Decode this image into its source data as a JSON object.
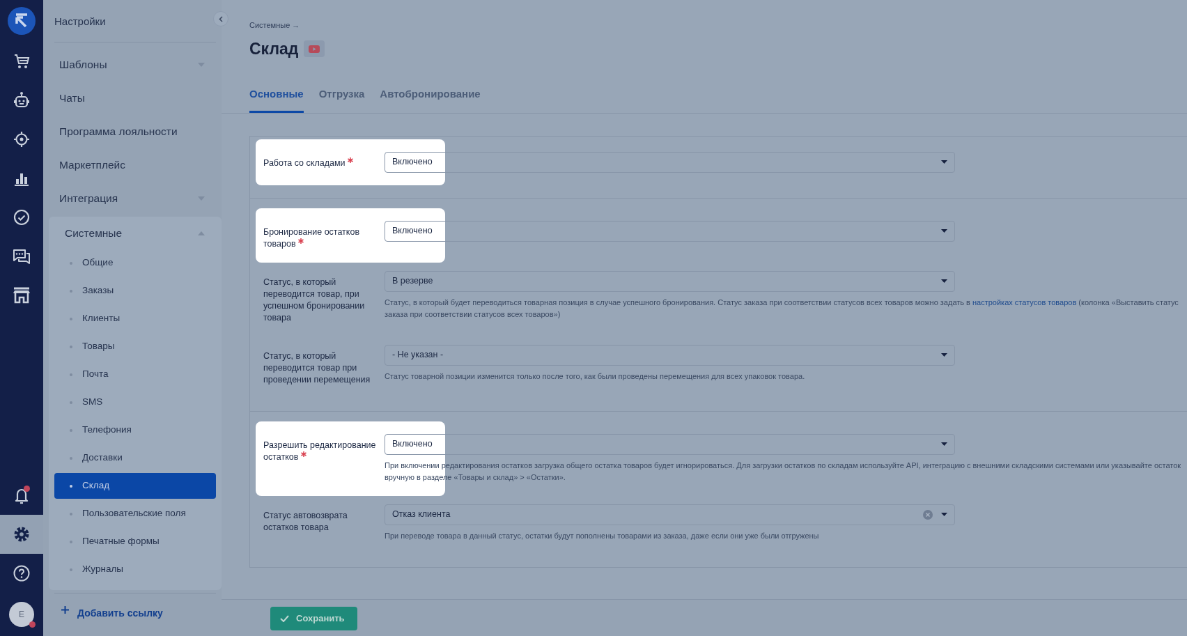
{
  "rail": {
    "top": [
      {
        "kind": "logo",
        "selected": false,
        "notification": false
      },
      {
        "kind": "cart",
        "selected": false,
        "notification": false
      },
      {
        "kind": "robot",
        "selected": false,
        "notification": false
      },
      {
        "kind": "target",
        "selected": false,
        "notification": false
      },
      {
        "kind": "chart",
        "selected": false,
        "notification": false
      },
      {
        "kind": "check",
        "selected": false,
        "notification": false
      },
      {
        "kind": "chat",
        "selected": false,
        "notification": false
      },
      {
        "kind": "store",
        "selected": false,
        "notification": false
      }
    ],
    "bottom": [
      {
        "kind": "bell",
        "selected": false,
        "notification": true
      },
      {
        "kind": "gear",
        "selected": true,
        "notification": false
      },
      {
        "kind": "help",
        "selected": false,
        "notification": false
      }
    ],
    "avatar": {
      "initial": "E",
      "notification": true
    }
  },
  "sidebar": {
    "title": "Настройки",
    "items": [
      {
        "label": "Шаблоны",
        "expandable": true,
        "expanded": false
      },
      {
        "label": "Чаты",
        "expandable": false,
        "expanded": false
      },
      {
        "label": "Программа лояльности",
        "expandable": false,
        "expanded": false
      },
      {
        "label": "Маркетплейс",
        "expandable": false,
        "expanded": false
      },
      {
        "label": "Интеграция",
        "expandable": true,
        "expanded": false
      },
      {
        "label": "Системные",
        "expandable": true,
        "expanded": true,
        "children": [
          {
            "label": "Общие",
            "selected": false
          },
          {
            "label": "Заказы",
            "selected": false
          },
          {
            "label": "Клиенты",
            "selected": false
          },
          {
            "label": "Товары",
            "selected": false
          },
          {
            "label": "Почта",
            "selected": false
          },
          {
            "label": "SMS",
            "selected": false
          },
          {
            "label": "Телефония",
            "selected": false
          },
          {
            "label": "Доставки",
            "selected": false
          },
          {
            "label": "Склад",
            "selected": true
          },
          {
            "label": "Пользовательские поля",
            "selected": false
          },
          {
            "label": "Печатные формы",
            "selected": false
          },
          {
            "label": "Журналы",
            "selected": false
          }
        ]
      }
    ],
    "add_link": "Добавить ссылку"
  },
  "breadcrumb": "Системные →",
  "title": "Склад",
  "tabs": [
    {
      "label": "Основные",
      "selected": true
    },
    {
      "label": "Отгрузка",
      "selected": false
    },
    {
      "label": "Автобронирование",
      "selected": false
    }
  ],
  "sections": [
    {
      "fields": [
        {
          "label": "Работа со складами",
          "required": true,
          "highlighted": true,
          "value": "Включено",
          "clearable": false
        }
      ]
    },
    {
      "fields": [
        {
          "label": "Бронирование остатков товаров",
          "required": true,
          "highlighted": true,
          "value": "Включено",
          "clearable": false
        },
        {
          "label": "Статус, в который переводится товар, при успешном бронировании товара",
          "required": false,
          "highlighted": false,
          "value": "В резерве",
          "clearable": false,
          "hint": "Статус, в который будет переводиться товарная позиция в случае успешного бронирования. Статус заказа при соответствии статусов всех товаров можно задать в ",
          "hint_link": "настройках статусов товаров",
          "hint_after": " (колонка «Выставить статус заказа при соответствии статусов всех товаров»)"
        },
        {
          "label": "Статус, в который переводится товар при проведении перемещения",
          "required": false,
          "highlighted": false,
          "value": "- Не указан -",
          "clearable": false,
          "hint": "Статус товарной позиции изменится только после того, как были проведены перемещения для всех упаковок товара."
        }
      ]
    },
    {
      "fields": [
        {
          "label": "Разрешить редактирование остатков",
          "required": true,
          "highlighted": true,
          "value": "Включено",
          "clearable": false,
          "hint": "При включении редактирования остатков загрузка общего остатка товаров будет игнорироваться. Для загрузки остатков по складам используйте API, интеграцию с внешними складскими системами или указывайте остаток вручную в разделе «Товары и склад» > «Остатки»."
        },
        {
          "label": "Статус автовозврата остатков товара",
          "required": false,
          "highlighted": false,
          "value": "Отказ клиента",
          "clearable": true,
          "hint": "При переводе товара в данный статус, остатки будут пополнены товарами из заказа, даже если они уже были отгружены"
        }
      ]
    }
  ],
  "save_button": "Сохранить"
}
